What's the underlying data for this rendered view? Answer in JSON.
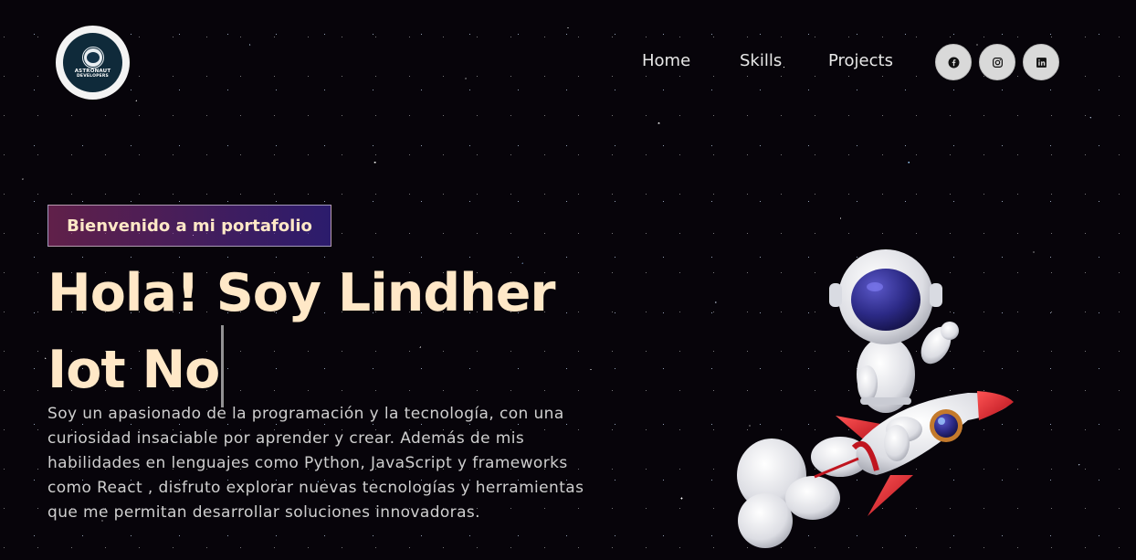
{
  "logo": {
    "line1": "ASTRONAUT",
    "line2": "DEVELOPERS"
  },
  "nav": {
    "home": "Home",
    "skills": "Skills",
    "projects": "Projects"
  },
  "social": [
    "facebook-icon",
    "instagram-icon",
    "linkedin-icon"
  ],
  "hero": {
    "tagline": "Bienvenido a mi portafolio",
    "headline": "Hola! Soy Lindher Iot No",
    "description": "Soy un apasionado de la programación y la tecnología, con una curiosidad insaciable por aprender y crear. Además de mis habilidades en lenguajes como Python, JavaScript y frameworks como React , disfruto explorar nuevas tecnologías y herramientas que me permitan desarrollar soluciones innovadoras."
  },
  "colors": {
    "background": "#07040a",
    "accent_text": "#ffe8c7",
    "badge_from": "#aa367c",
    "badge_to": "#4a2fbd"
  }
}
